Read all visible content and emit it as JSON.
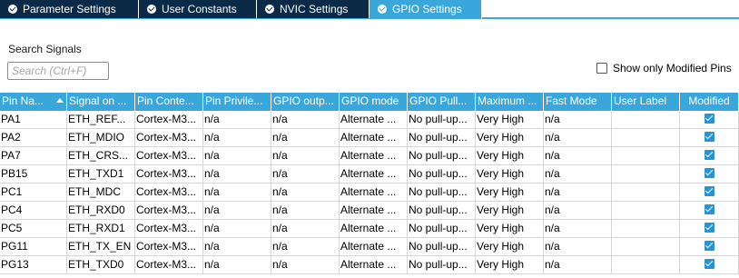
{
  "tabs": [
    {
      "label": "Parameter Settings"
    },
    {
      "label": "User Constants"
    },
    {
      "label": "NVIC Settings"
    },
    {
      "label": "GPIO Settings"
    }
  ],
  "active_tab": "GPIO Settings",
  "search": {
    "label": "Search Signals",
    "placeholder": "Search (Ctrl+F)",
    "value": ""
  },
  "show_only_modified": {
    "label": "Show only Modified Pins",
    "checked": false
  },
  "table": {
    "columns": [
      "Pin Na...",
      "Signal on ...",
      "Pin Conte...",
      "Pin Privile...",
      "GPIO outp...",
      "GPIO mode",
      "GPIO Pull...",
      "Maximum ...",
      "Fast Mode",
      "User Label",
      "Modified"
    ],
    "sorted_column": "Pin Na...",
    "sort_direction": "ascending",
    "rows": [
      {
        "pin": "PA1",
        "signal": "ETH_REF...",
        "context": "Cortex-M3...",
        "privilege": "n/a",
        "output": "n/a",
        "mode": "Alternate ...",
        "pull": "No pull-up...",
        "speed": "Very High",
        "fast": "n/a",
        "user_label": "",
        "modified": true
      },
      {
        "pin": "PA2",
        "signal": "ETH_MDIO",
        "context": "Cortex-M3...",
        "privilege": "n/a",
        "output": "n/a",
        "mode": "Alternate ...",
        "pull": "No pull-up...",
        "speed": "Very High",
        "fast": "n/a",
        "user_label": "",
        "modified": true
      },
      {
        "pin": "PA7",
        "signal": "ETH_CRS...",
        "context": "Cortex-M3...",
        "privilege": "n/a",
        "output": "n/a",
        "mode": "Alternate ...",
        "pull": "No pull-up...",
        "speed": "Very High",
        "fast": "n/a",
        "user_label": "",
        "modified": true
      },
      {
        "pin": "PB15",
        "signal": "ETH_TXD1",
        "context": "Cortex-M3...",
        "privilege": "n/a",
        "output": "n/a",
        "mode": "Alternate ...",
        "pull": "No pull-up...",
        "speed": "Very High",
        "fast": "n/a",
        "user_label": "",
        "modified": true
      },
      {
        "pin": "PC1",
        "signal": "ETH_MDC",
        "context": "Cortex-M3...",
        "privilege": "n/a",
        "output": "n/a",
        "mode": "Alternate ...",
        "pull": "No pull-up...",
        "speed": "Very High",
        "fast": "n/a",
        "user_label": "",
        "modified": true
      },
      {
        "pin": "PC4",
        "signal": "ETH_RXD0",
        "context": "Cortex-M3...",
        "privilege": "n/a",
        "output": "n/a",
        "mode": "Alternate ...",
        "pull": "No pull-up...",
        "speed": "Very High",
        "fast": "n/a",
        "user_label": "",
        "modified": true
      },
      {
        "pin": "PC5",
        "signal": "ETH_RXD1",
        "context": "Cortex-M3...",
        "privilege": "n/a",
        "output": "n/a",
        "mode": "Alternate ...",
        "pull": "No pull-up...",
        "speed": "Very High",
        "fast": "n/a",
        "user_label": "",
        "modified": true
      },
      {
        "pin": "PG11",
        "signal": "ETH_TX_EN",
        "context": "Cortex-M3...",
        "privilege": "n/a",
        "output": "n/a",
        "mode": "Alternate ...",
        "pull": "No pull-up...",
        "speed": "Very High",
        "fast": "n/a",
        "user_label": "",
        "modified": true
      },
      {
        "pin": "PG13",
        "signal": "ETH_TXD0",
        "context": "Cortex-M3...",
        "privilege": "n/a",
        "output": "n/a",
        "mode": "Alternate ...",
        "pull": "No pull-up...",
        "speed": "Very High",
        "fast": "n/a",
        "user_label": "",
        "modified": true
      }
    ]
  },
  "colors": {
    "tab_inactive": "#0b2a48",
    "tab_active": "#3aa7dc",
    "header_bg": "#3aa7dc",
    "checkbox": "#2c93d3"
  }
}
